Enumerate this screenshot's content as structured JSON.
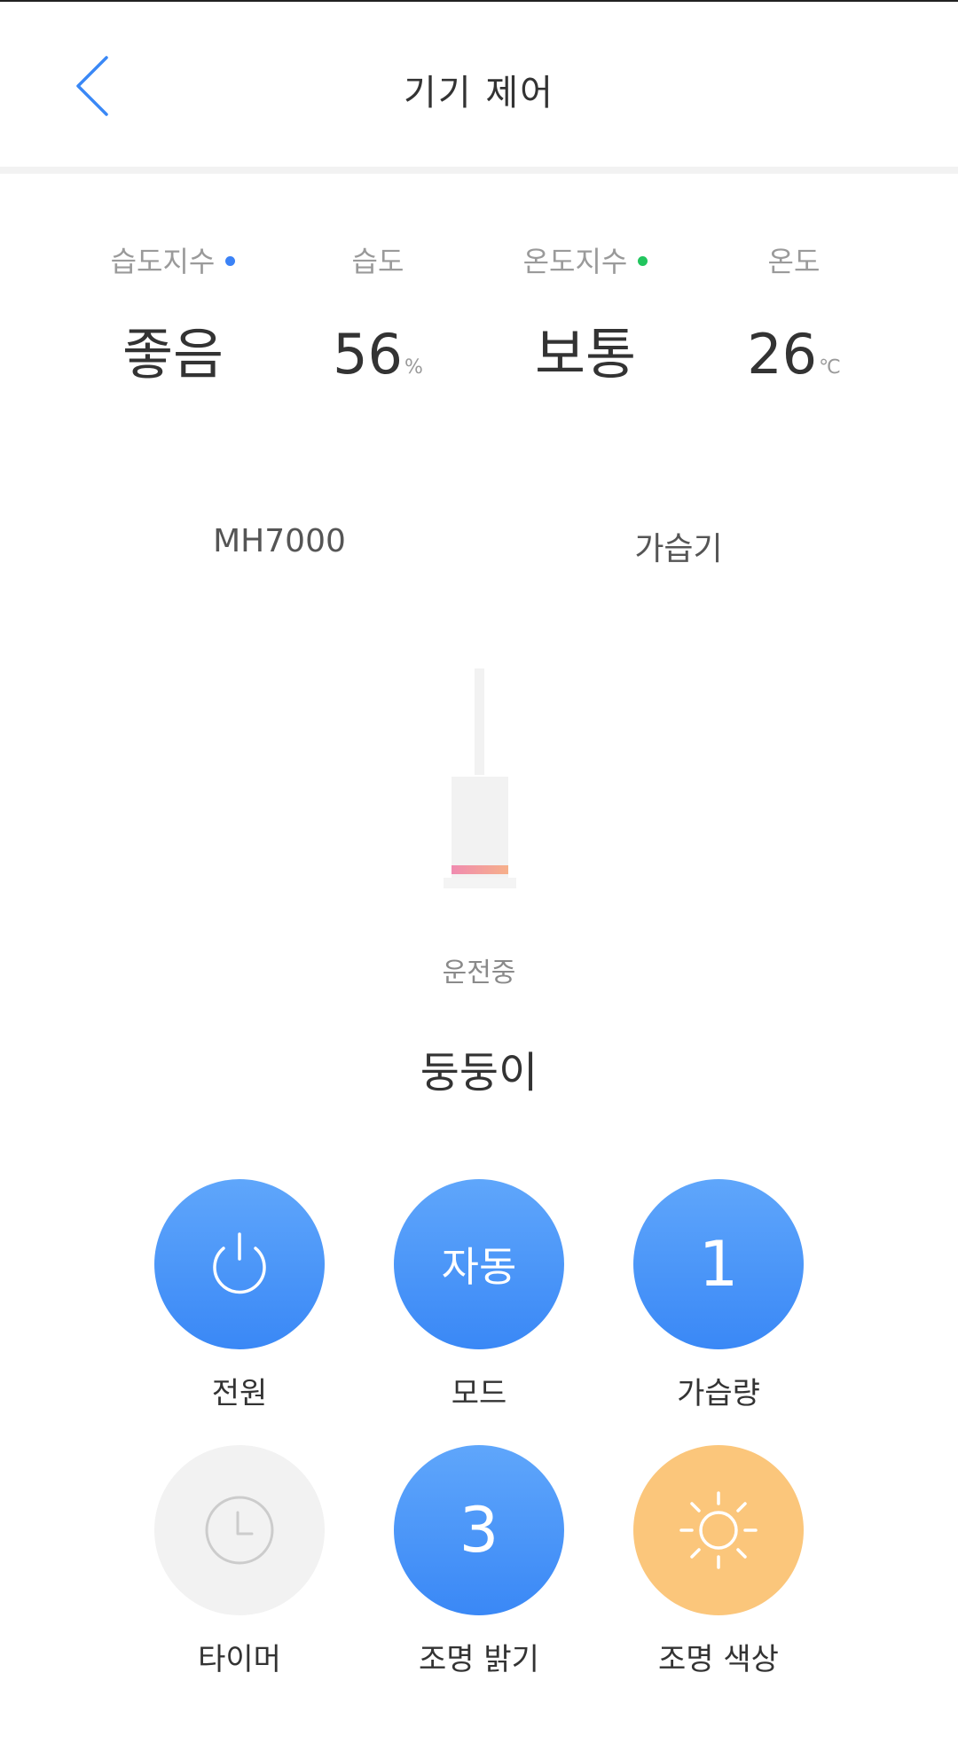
{
  "header": {
    "title": "기기 제어"
  },
  "stats": [
    {
      "label": "습도지수",
      "value": "좋음",
      "unit": "",
      "dot_color": "#3b82f6"
    },
    {
      "label": "습도",
      "value": "56",
      "unit": "%",
      "dot_color": ""
    },
    {
      "label": "온도지수",
      "value": "보통",
      "unit": "",
      "dot_color": "#22c55e"
    },
    {
      "label": "온도",
      "value": "26",
      "unit": "℃",
      "dot_color": ""
    }
  ],
  "device": {
    "model": "MH7000",
    "type": "가습기",
    "status": "운전중",
    "name": "둥둥이"
  },
  "controls": [
    {
      "label": "전원",
      "display": "",
      "icon": "power-icon",
      "color": "blue"
    },
    {
      "label": "모드",
      "display": "자동",
      "icon": "",
      "color": "blue"
    },
    {
      "label": "가습량",
      "display": "1",
      "icon": "",
      "color": "blue"
    },
    {
      "label": "타이머",
      "display": "",
      "icon": "clock-icon",
      "color": "gray"
    },
    {
      "label": "조명 밝기",
      "display": "3",
      "icon": "",
      "color": "blue"
    },
    {
      "label": "조명 색상",
      "display": "",
      "icon": "sun-icon",
      "color": "orange"
    }
  ],
  "colors": {
    "accent_blue": "#3a88f6",
    "light_orange": "#fbc67b",
    "back_arrow": "#3a88f6"
  }
}
